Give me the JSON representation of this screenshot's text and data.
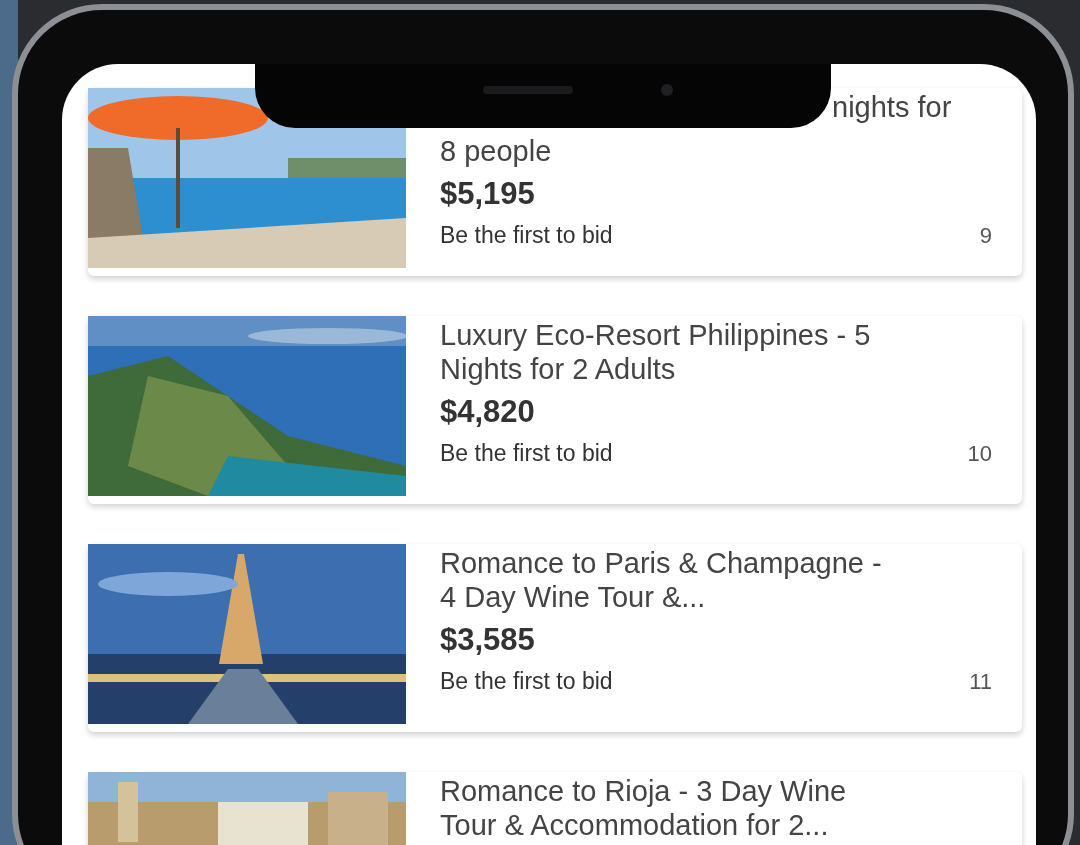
{
  "listings": [
    {
      "title_lines": [
        "nights for",
        "8 people"
      ],
      "first_line_partly_hidden": true,
      "price": "$5,195",
      "bid_status": "Be the first to bid",
      "number": "9"
    },
    {
      "title_lines": [
        "Luxury Eco-Resort Philippines - 5",
        "Nights for 2 Adults"
      ],
      "first_line_partly_hidden": false,
      "price": "$4,820",
      "bid_status": "Be the first to bid",
      "number": "10"
    },
    {
      "title_lines": [
        "Romance to Paris & Champagne -",
        "4 Day Wine Tour &..."
      ],
      "first_line_partly_hidden": false,
      "price": "$3,585",
      "bid_status": "Be the first to bid",
      "number": "11"
    },
    {
      "title_lines": [
        "Romance to Rioja - 3 Day Wine",
        "Tour & Accommodation for 2..."
      ],
      "first_line_partly_hidden": false
    }
  ]
}
